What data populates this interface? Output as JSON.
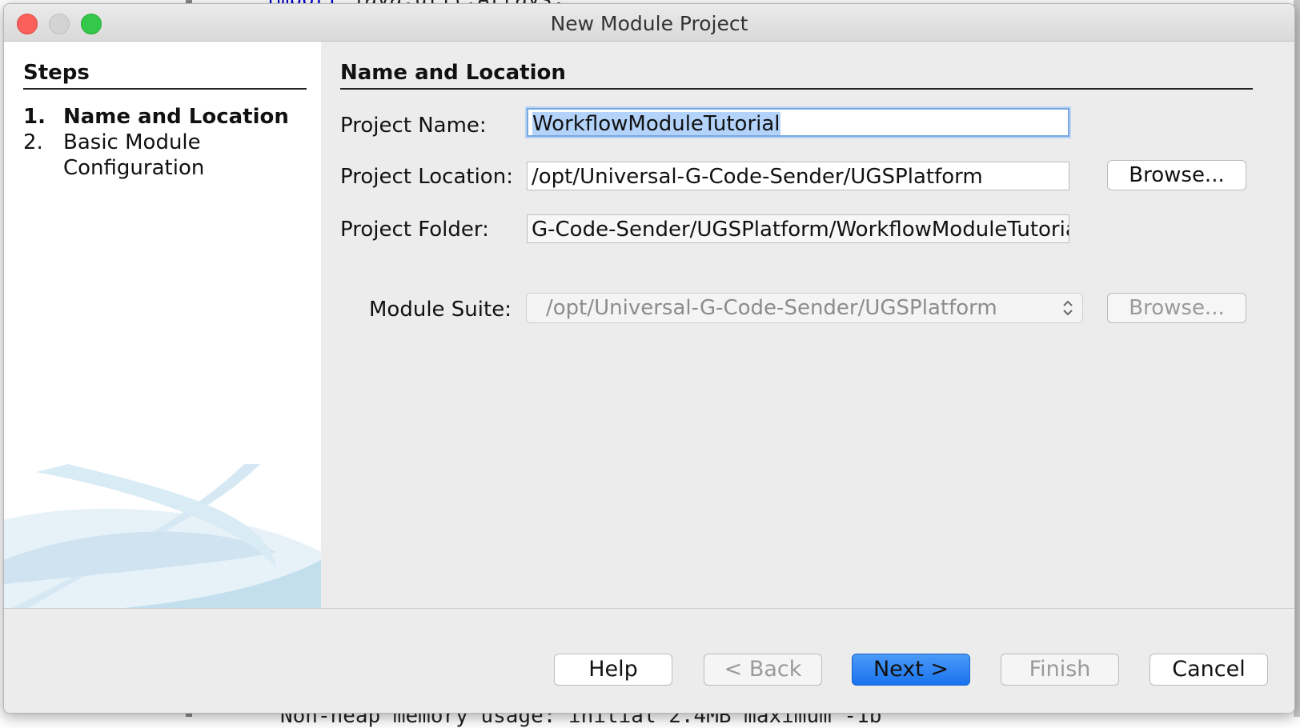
{
  "background": {
    "top_code_keyword": "import",
    "top_code_rest": " java.util.Arrays;",
    "bottom_code": "Non-heap memory usage: initial 2.4MB maximum -1b"
  },
  "dialog": {
    "title": "New Module Project",
    "steps": {
      "title": "Steps",
      "items": [
        {
          "num": "1.",
          "label": "Name and Location",
          "active": true
        },
        {
          "num": "2.",
          "label": "Basic Module Configuration",
          "active": false
        }
      ]
    },
    "section_title": "Name and Location",
    "fields": {
      "project_name_label": "Project Name:",
      "project_name_value": "WorkflowModuleTutorial",
      "project_location_label": "Project Location:",
      "project_location_value": "/opt/Universal-G-Code-Sender/UGSPlatform",
      "project_folder_label": "Project Folder:",
      "project_folder_value": "G-Code-Sender/UGSPlatform/WorkflowModuleTutorial",
      "module_suite_label": "Module Suite:",
      "module_suite_value": "/opt/Universal-G-Code-Sender/UGSPlatform"
    },
    "browse_label": "Browse...",
    "buttons": {
      "help": "Help",
      "back": "< Back",
      "next": "Next >",
      "finish": "Finish",
      "cancel": "Cancel"
    },
    "colors": {
      "primary_button": "#1a73ee",
      "selection": "#b3d3fb",
      "close": "#fc605b",
      "maximize": "#34c84a"
    }
  }
}
